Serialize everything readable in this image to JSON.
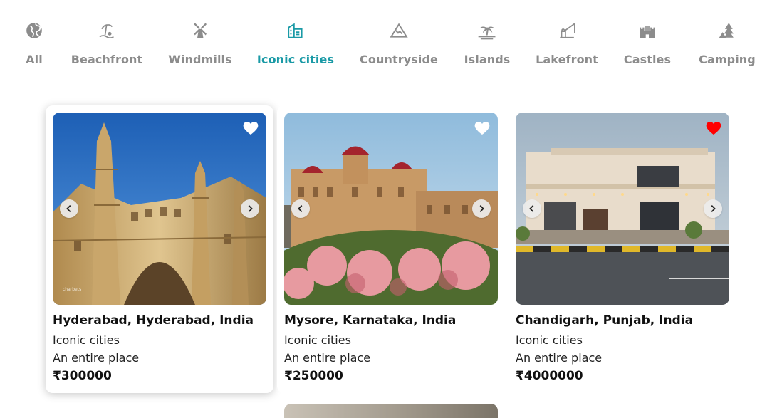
{
  "categories": [
    {
      "label": "All",
      "icon": "globe-icon",
      "active": false
    },
    {
      "label": "Beachfront",
      "icon": "beach-icon",
      "active": false
    },
    {
      "label": "Windmills",
      "icon": "windmill-icon",
      "active": false
    },
    {
      "label": "Iconic cities",
      "icon": "building-icon",
      "active": true
    },
    {
      "label": "Countryside",
      "icon": "mountain-icon",
      "active": false
    },
    {
      "label": "Islands",
      "icon": "island-icon",
      "active": false
    },
    {
      "label": "Lakefront",
      "icon": "fishing-icon",
      "active": false
    },
    {
      "label": "Castles",
      "icon": "castle-icon",
      "active": false
    },
    {
      "label": "Camping",
      "icon": "camping-icon",
      "active": false
    }
  ],
  "colors": {
    "active": "#1a9aa6",
    "inactive": "#8c8c8c",
    "liked": "#ff0000"
  },
  "listings": [
    {
      "title": "Hyderabad, Hyderabad, India",
      "category": "Iconic cities",
      "type": "An entire place",
      "price": "₹300000",
      "liked": false,
      "photo_caption": "charbets"
    },
    {
      "title": "Mysore, Karnataka, India",
      "category": "Iconic cities",
      "type": "An entire place",
      "price": "₹250000",
      "liked": false
    },
    {
      "title": "Chandigarh, Punjab, India",
      "category": "Iconic cities",
      "type": "An entire place",
      "price": "₹4000000",
      "liked": true
    }
  ]
}
